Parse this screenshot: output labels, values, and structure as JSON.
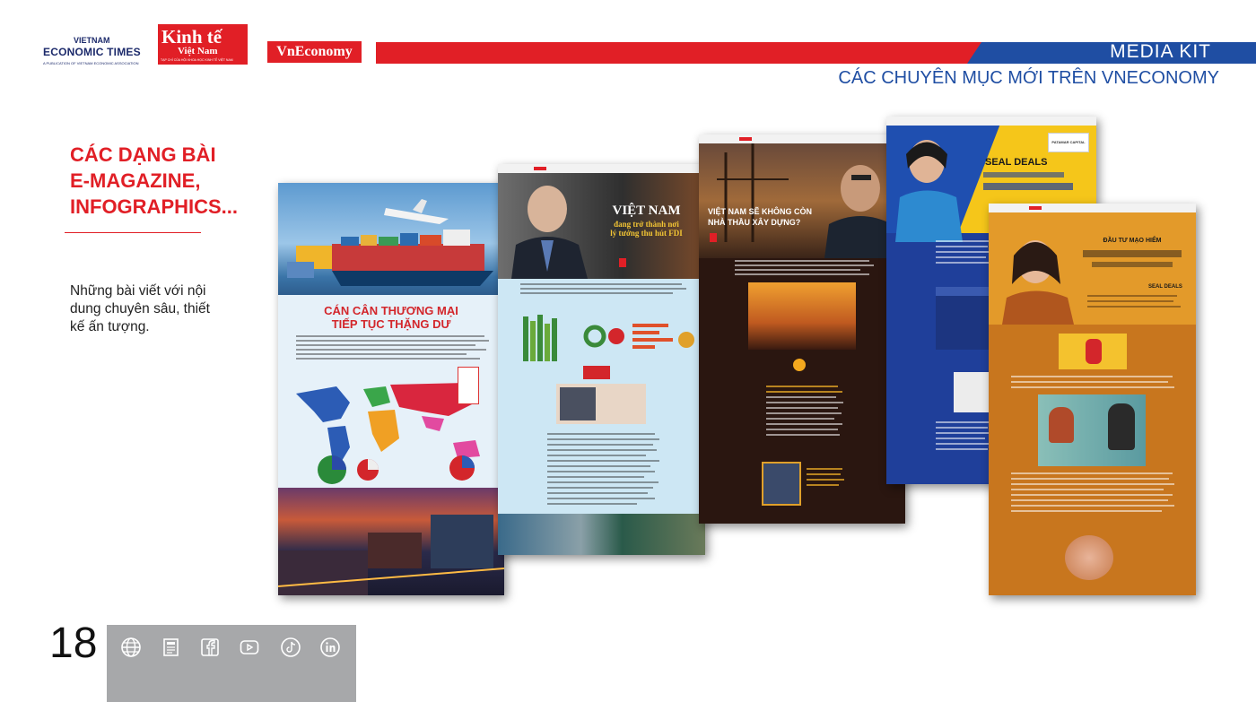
{
  "header": {
    "logos": {
      "vet_line1": "VIETNAM",
      "vet_line2": "ECONOMIC TIMES",
      "vet_tagline": "A PUBLICATION OF VIETNAM ECONOMIC ASSOCIATION",
      "kt_line1": "Kinh tế",
      "kt_line2": "Việt Nam",
      "kt_tagline": "TẠP CHÍ CỦA HỘI KHOA HỌC KINH TẾ VIỆT NAM",
      "vne": "VnEconomy"
    },
    "title": "MEDIA KIT",
    "subtitle": "CÁC CHUYÊN MỤC MỚI TRÊN VNECONOMY"
  },
  "section": {
    "heading_lines": [
      "CÁC DẠNG BÀI",
      "E-MAGAZINE,",
      "INFOGRAPHICS..."
    ],
    "description": "Những bài viết với nội dung chuyên sâu, thiết kế ấn tượng."
  },
  "footer": {
    "page_number": "18",
    "icons": [
      "globe-icon",
      "newspaper-icon",
      "facebook-icon",
      "youtube-icon",
      "tiktok-icon",
      "linkedin-icon"
    ]
  },
  "samples": {
    "s1": {
      "headline_1": "CÁN CÂN THƯƠNG MẠI",
      "headline_2": "TIẾP TỤC THẶNG DƯ"
    },
    "s2": {
      "headline_1": "VIỆT NAM",
      "headline_2": "đang trở thành nơi",
      "headline_3": "lý tưởng thu hút FDI"
    },
    "s3": {
      "headline_1": "VIỆT NAM SẼ KHÔNG CÒN",
      "headline_2": "NHÀ THẦU XÂY DỰNG?"
    },
    "s4": {
      "brand": "SEAL DEALS",
      "logo": "PATAMAR CAPITAL"
    },
    "s5": {
      "headline_1": "ĐẦU TƯ MẠO HIỂM",
      "brand": "SEAL DEALS"
    }
  },
  "colors": {
    "red": "#e11f26",
    "blue": "#1f4ea3",
    "footer_gray": "#a7a8aa"
  }
}
